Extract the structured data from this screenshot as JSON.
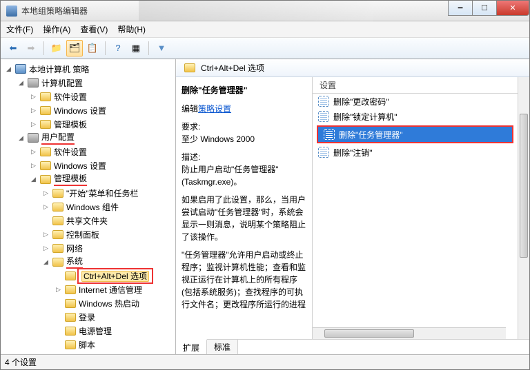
{
  "title": "本地组策略编辑器",
  "menu": {
    "file": "文件(F)",
    "action": "操作(A)",
    "view": "查看(V)",
    "help": "帮助(H)"
  },
  "tree": {
    "root": "本地计算机 策略",
    "computer": "计算机配置",
    "c_soft": "软件设置",
    "c_win": "Windows 设置",
    "c_adm": "管理模板",
    "user": "用户配置",
    "u_soft": "软件设置",
    "u_win": "Windows 设置",
    "u_adm": "管理模板",
    "start": "\"开始\"菜单和任务栏",
    "wincomp": "Windows 组件",
    "share": "共享文件夹",
    "control": "控制面板",
    "network": "网络",
    "system": "系统",
    "cad": "Ctrl+Alt+Del 选项",
    "inet": "Internet 通信管理",
    "whot": "Windows 热启动",
    "login": "登录",
    "power": "电源管理",
    "script": "脚本"
  },
  "right": {
    "header": "Ctrl+Alt+Del 选项",
    "desc": {
      "title": "删除\"任务管理器\"",
      "edit_link": "策略设置",
      "edit_prefix": "编辑",
      "req_label": "要求:",
      "req_val": "至少 Windows 2000",
      "desc_label": "描述:",
      "p1": "防止用户启动\"任务管理器\"(Taskmgr.exe)。",
      "p2": "如果启用了此设置，那么，当用户尝试启动\"任务管理器\"时，系统会显示一则消息，说明某个策略阻止了该操作。",
      "p3": "\"任务管理器\"允许用户启动或终止程序；监视计算机性能；查看和监视正运行在计算机上的所有程序(包括系统服务)；查找程序的可执行文件名；更改程序所运行的进程"
    },
    "colhdr": "设置",
    "items": {
      "i0": "删除\"更改密码\"",
      "i1": "删除\"锁定计算机\"",
      "i2": "删除\"任务管理器\"",
      "i3": "删除\"注销\""
    },
    "tabs": {
      "t0": "扩展",
      "t1": "标准"
    }
  },
  "status": "4 个设置"
}
